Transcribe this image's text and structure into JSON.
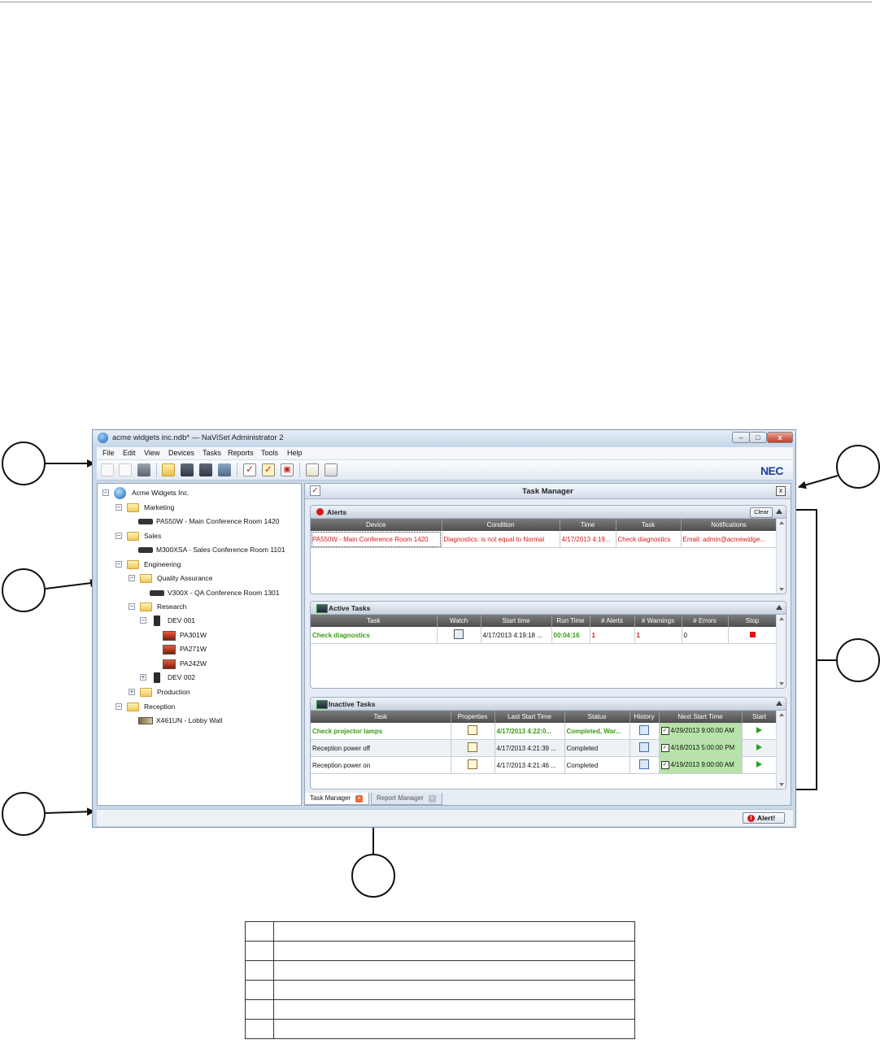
{
  "window": {
    "title": "acme widgets inc.ndb* — NaViSet Administrator 2",
    "controls": {
      "minimize": "–",
      "maximize": "□",
      "close": "x"
    }
  },
  "menu": [
    "File",
    "Edit",
    "View",
    "Devices",
    "Tasks",
    "Reports",
    "Tools",
    "Help"
  ],
  "toolbar": {
    "logo": "NEC",
    "buttons": [
      "new-document-icon",
      "open-document-icon",
      "save-icon",
      "add-folder-icon",
      "add-device-icon",
      "add-multiple-devices-icon",
      "device-properties-icon",
      "new-task-icon",
      "run-task-icon",
      "schedule-task-icon",
      "new-report-icon",
      "report-icon"
    ]
  },
  "tree": {
    "root": "Acme Widgets Inc.",
    "marketing": "Marketing",
    "marketing_device": "PA550W - Main Conference Room 1420",
    "sales": "Sales",
    "sales_device": "M300XSA - Sales Conference Room 1101",
    "engineering": "Engineering",
    "qa": "Quality Assurance",
    "qa_device": "V300X - QA Conference Room 1301",
    "research": "Research",
    "dev001": "DEV 001",
    "monitors": [
      "PA301W",
      "PA271W",
      "PA242W"
    ],
    "dev002": "DEV 002",
    "production": "Production",
    "reception": "Reception",
    "reception_device": "X461UN - Lobby Wall"
  },
  "task_manager": {
    "title": "Task Manager",
    "close": "x",
    "alerts": {
      "title": "Alerts",
      "clear": "Clear",
      "columns": [
        "Device",
        "Condition",
        "Time",
        "Task",
        "Notifications"
      ],
      "rows": [
        [
          "PA550W - Main Conference Room 1420",
          "Diagnostics: is not equal to Normal",
          "4/17/2013 4:19...",
          "Check diagnostics",
          "Email: admin@acmewidge..."
        ]
      ]
    },
    "active": {
      "title": "Active Tasks",
      "columns": [
        "Task",
        "Watch",
        "Start time",
        "Run Time",
        "# Alerts",
        "# Warnings",
        "# Errors",
        "Stop"
      ],
      "rows": [
        {
          "task": "Check diagnostics",
          "start": "4/17/2013 4:19:18 ...",
          "run": "00:04:16",
          "alerts": "1",
          "warnings": "1",
          "errors": "0"
        }
      ]
    },
    "inactive": {
      "title": "Inactive Tasks",
      "columns": [
        "Task",
        "Properties",
        "Last Start Time",
        "Status",
        "History",
        "Next Start Time",
        "Start"
      ],
      "rows": [
        {
          "task": "Check projector lamps",
          "last": "4/17/2013 4:22:0...",
          "status": "Completed, War...",
          "next": "4/29/2013 9:00:00 AM"
        },
        {
          "task": "Reception power off",
          "last": "4/17/2013 4:21:39 ...",
          "status": "Completed",
          "next": "4/18/2013 5:00:00 PM"
        },
        {
          "task": "Reception power on",
          "last": "4/17/2013 4:21:46 ...",
          "status": "Completed",
          "next": "4/19/2013 9:00:00 AM"
        }
      ]
    }
  },
  "tabs": [
    "Task Manager",
    "Report Manager"
  ],
  "status": {
    "alert_button": "Alert!"
  },
  "colors": {
    "alert_red": "#d21a1a",
    "task_green": "#3a9c12",
    "next_start_bg": "#b6e3a8",
    "nec_blue": "#1d3f95"
  }
}
